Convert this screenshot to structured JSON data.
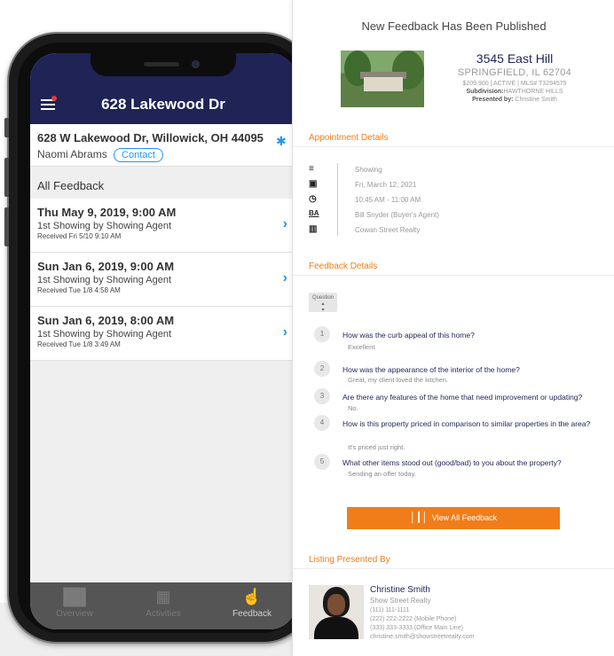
{
  "phone": {
    "header_title": "628 Lakewood Dr",
    "address": "628 W Lakewood Dr, Willowick, OH 44095",
    "owner": "Naomi Abrams",
    "contact_label": "Contact",
    "section_title": "All Feedback",
    "feedback": [
      {
        "date": "Thu May 9, 2019, 9:00 AM",
        "subtitle": "1st Showing by Showing Agent",
        "received": "Received Fri 5/10 9:10 AM"
      },
      {
        "date": "Sun Jan 6, 2019, 9:00 AM",
        "subtitle": "1st Showing by Showing Agent",
        "received": "Received Tue 1/8 4:58 AM"
      },
      {
        "date": "Sun Jan 6, 2019, 8:00 AM",
        "subtitle": "1st Showing by Showing Agent",
        "received": "Received Tue 1/8 3:49 AM"
      }
    ],
    "tabs": [
      {
        "label": "Overview",
        "icon": "bar-chart-icon"
      },
      {
        "label": "Activities",
        "icon": "calendar-icon"
      },
      {
        "label": "Feedback",
        "icon": "thumbs-up-icon",
        "active": true
      }
    ]
  },
  "email": {
    "title": "New Feedback Has Been Published",
    "listing": {
      "street": "3545 East Hill",
      "city": "SPRINGFIELD, IL 62704",
      "meta": "$209,900 | ACTIVE | MLS# T3294575",
      "subdivision_label": "Subdivision:",
      "subdivision": "HAWTHORNE HILLS",
      "presented_label": "Presented by:",
      "presented_by": "Christine Smith"
    },
    "appointment_heading": "Appointment Details",
    "appointment": [
      {
        "icon": "sign-icon",
        "text": "Showing"
      },
      {
        "icon": "calendar-icon",
        "text": "Fri, March 12, 2021"
      },
      {
        "icon": "clock-icon",
        "text": "10:45 AM - 11:00 AM"
      },
      {
        "icon": "ba-icon",
        "text": "Bill Snyder (Buyer's Agent)"
      },
      {
        "icon": "building-icon",
        "text": "Cowan Street Realty"
      }
    ],
    "feedback_heading": "Feedback Details",
    "question_select": "Question",
    "questions": [
      {
        "num": "1",
        "q": "How was the curb appeal of this home?",
        "a": "Excellent"
      },
      {
        "num": "2",
        "q": "How was the appearance of the interior of the home?",
        "a": "Great, my client loved the kitchen."
      },
      {
        "num": "3",
        "q": "Are there any features of the home that need improvement or updating?",
        "a": "No."
      },
      {
        "num": "4",
        "q": "How is this property priced in comparison to similar properties in the area?",
        "a": "It's priced just right."
      },
      {
        "num": "5",
        "q": "What other items stood out (good/bad) to you about the property?",
        "a": "Sending an offer today."
      }
    ],
    "view_all_label": "View All Feedback",
    "presented_heading": "Listing Presented By",
    "agent": {
      "name": "Christine Smith",
      "company": "Show Street Realty",
      "phone1": "(111) 111-1111",
      "phone2": "(222) 222-2222 (Mobile Phone)",
      "phone3": "(333) 333-3333 (Office Main Line)",
      "email": "christine.smith@showstreetrealty.com"
    }
  },
  "colors": {
    "navy": "#1f2356",
    "accent_blue": "#2196f3",
    "orange": "#f07d1a"
  }
}
